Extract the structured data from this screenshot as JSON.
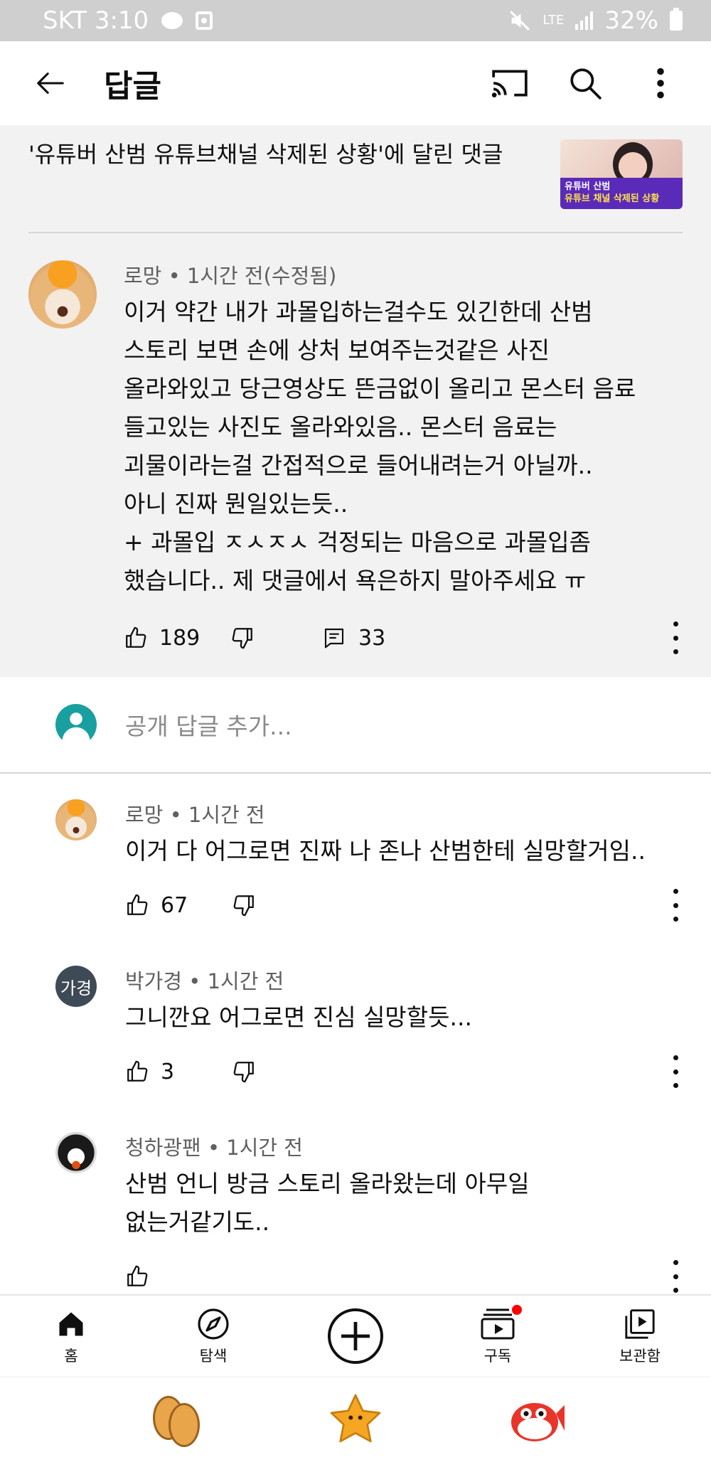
{
  "status_bar": {
    "carrier_time": "SKT 3:10",
    "network": "LTE",
    "battery": "32%"
  },
  "app_bar": {
    "title": "답글",
    "back_icon": "arrow-left-icon",
    "cast_icon": "cast-icon",
    "search_icon": "search-icon",
    "more_icon": "more-vert-icon"
  },
  "video_ref": {
    "text": "'유튜버 산범 유튜브채널 삭제된 상황'에 달린 댓글",
    "thumb_line1": "유튜버 산범",
    "thumb_line2": "유튜브 채널 삭제된 상황"
  },
  "main_comment": {
    "author_meta": "로망 • 1시간 전(수정됨)",
    "text": "이거 약간 내가 과몰입하는걸수도 있긴한데 산범\n스토리 보면 손에 상처 보여주는것같은 사진\n올라와있고 당근영상도 뜬금없이 올리고 몬스터 음료\n들고있는 사진도 올라와있음.. 몬스터 음료는\n괴물이라는걸 간접적으로 들어내려는거 아닐까..\n아니 진짜 뭔일있는듯..\n+ 과몰입 ㅈㅅㅈㅅ 걱정되는 마음으로 과몰입좀\n했습니다.. 제 댓글에서 욕은하지 말아주세요 ㅠ",
    "likes": "189",
    "replies": "33"
  },
  "add_reply": {
    "placeholder": "공개 답글 추가..."
  },
  "replies": [
    {
      "author_meta": "로망 • 1시간 전",
      "text": "이거 다 어그로면 진짜 나 존나 산범한테 실망할거임..",
      "likes": "67"
    },
    {
      "author_meta": "박가경 • 1시간 전",
      "avatar_text": "가경",
      "text": "그니깐요 어그로면 진심 실망할듯...",
      "likes": "3"
    },
    {
      "author_meta": "청하광팬 • 1시간 전",
      "text": "산범 언니 방금 스토리 올라왔는데 아무일\n없는거같기도..",
      "likes": ""
    }
  ],
  "bottom_nav": {
    "home": "홈",
    "explore": "탐색",
    "subscriptions": "구독",
    "library": "보관함"
  },
  "colors": {
    "accent_red": "#ff0000",
    "thumb_purple": "#5a2ab8",
    "avatar_teal": "#1a9fa0"
  }
}
